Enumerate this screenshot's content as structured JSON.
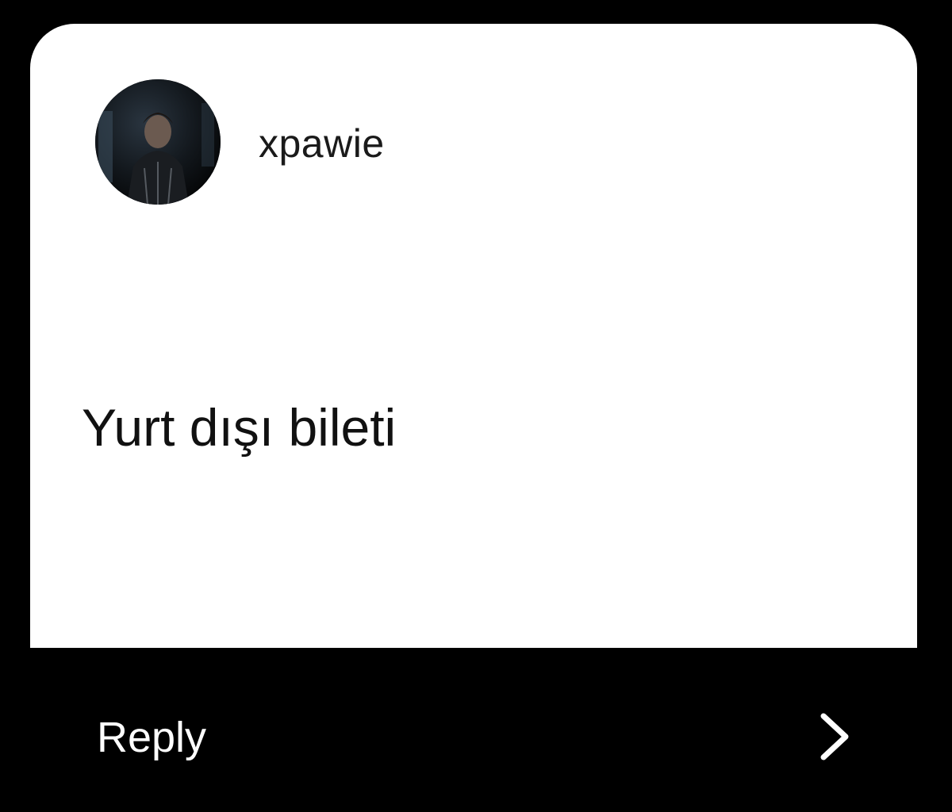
{
  "card": {
    "username": "xpawie",
    "question": "Yurt dışı bileti"
  },
  "reply": {
    "label": "Reply",
    "icon": "chevron-right-icon"
  },
  "colors": {
    "background": "#000000",
    "card": "#ffffff",
    "text": "#111111",
    "reply_text": "#ffffff"
  }
}
